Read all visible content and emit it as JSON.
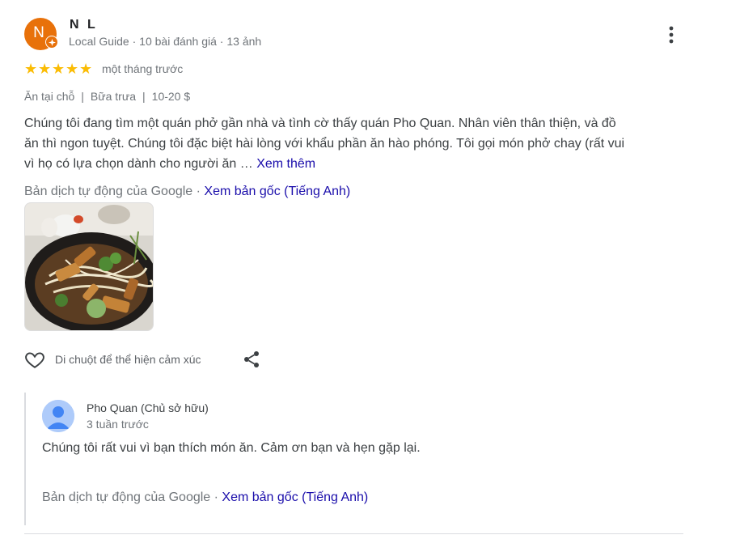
{
  "review": {
    "avatar_letter": "N",
    "author_name": "N L",
    "author_meta": "Local Guide · 10 bài đánh giá · 13 ảnh",
    "rating": 5,
    "stars": [
      "★",
      "★",
      "★",
      "★",
      "★"
    ],
    "time": "một tháng trước",
    "tags": [
      "Ăn tại chỗ",
      "Bữa trưa",
      "10-20 $"
    ],
    "tag_separator": "|",
    "text_line1": "Chúng tôi đang tìm một quán phở gần nhà và tình cờ thấy quán Pho Quan. Nhân viên thân thiện, và đồ",
    "text_line2": "ăn thì ngon tuyệt. Chúng tôi đặc biệt hài lòng với khẩu phần ăn hào phóng. Tôi gọi món phở chay (rất vui",
    "text_line3": "vì họ có lựa chọn dành cho người ăn …",
    "more_label": "Xem thêm",
    "translation_note": "Bản dịch tự động của Google · ",
    "view_original": "Xem bản gốc (Tiếng Anh)",
    "react_label": "Di chuột để thể hiện cảm xúc",
    "icons": [
      "guide-badge-icon",
      "more-vert-icon",
      "star-icon",
      "heart-icon",
      "share-icon",
      "person-icon"
    ],
    "colors": {
      "avatar": "#e8710a",
      "star": "#fbbc04",
      "link": "#1a0dab"
    }
  },
  "owner_reply": {
    "name": "Pho Quan (Chủ sở hữu)",
    "time": "3 tuần trước",
    "text": "Chúng tôi rất vui vì bạn thích món ăn. Cảm ơn bạn và hẹn gặp lại.",
    "translation_note": "Bản dịch tự động của Google · ",
    "view_original": "Xem bản gốc (Tiếng Anh)"
  }
}
